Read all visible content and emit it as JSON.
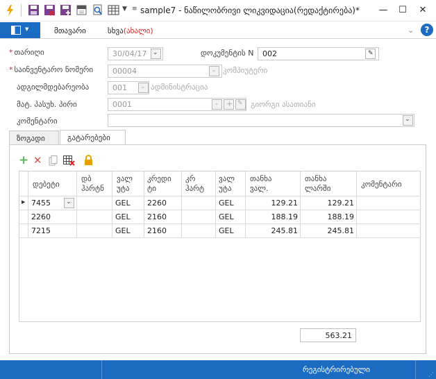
{
  "window": {
    "title": "sample7 - ნაწილობრივი ლიკვიდაცია(რედაქტირება)*",
    "minimize": "—",
    "maximize": "☐",
    "close": "✕"
  },
  "ribbon": {
    "menu": [
      {
        "label": "მთავარი"
      },
      {
        "label": "სხვა",
        "extra": "(ახალი)"
      }
    ],
    "help": "?"
  },
  "form": {
    "date_label": "თარიღი",
    "date_value": "30/04/17",
    "docnum_label": "დოკუმენტის N",
    "docnum_value": "002",
    "inventory_label": "საინვენტარო ნომერი",
    "inventory_value": "00004",
    "inventory_hint": "კომპიუტერი",
    "location_label": "ადგილმდებარეობა",
    "location_value": "001",
    "location_hint": "ადმინისტრაცია",
    "person_label": "მატ. პასუხ. პირი",
    "person_value": "0001",
    "person_hint": "გიორგი ასათიანი",
    "comment_label": "კომენტარი",
    "comment_value": ""
  },
  "tabs": [
    {
      "label": "ზოგადი"
    },
    {
      "label": "გატარებები"
    }
  ],
  "grid": {
    "headers": [
      "დებეტი",
      "დბ ჰარტნ",
      "ვალ უტა",
      "კრედი ტი",
      "კრ ჰარტ",
      "ვალ უტა",
      "თანხა ვალ.",
      "თანხა ლარში",
      "კომენტარი"
    ],
    "rows": [
      {
        "debit": "7455",
        "dpart": "",
        "cur1": "GEL",
        "credit": "2260",
        "cpart": "",
        "cur2": "GEL",
        "amount_cur": "129.21",
        "amount_gel": "129.21",
        "comment": ""
      },
      {
        "debit": "2260",
        "dpart": "",
        "cur1": "GEL",
        "credit": "2160",
        "cpart": "",
        "cur2": "GEL",
        "amount_cur": "188.19",
        "amount_gel": "188.19",
        "comment": ""
      },
      {
        "debit": "7215",
        "dpart": "",
        "cur1": "GEL",
        "credit": "2160",
        "cpart": "",
        "cur2": "GEL",
        "amount_cur": "245.81",
        "amount_gel": "245.81",
        "comment": ""
      }
    ],
    "total": "563.21"
  },
  "status": {
    "text": "რეგისტრირებული"
  },
  "colors": {
    "accent": "#1a6bc1",
    "required": "#d22222",
    "add": "#5cb85c",
    "delete": "#d9534f",
    "lock": "#e6a100"
  }
}
